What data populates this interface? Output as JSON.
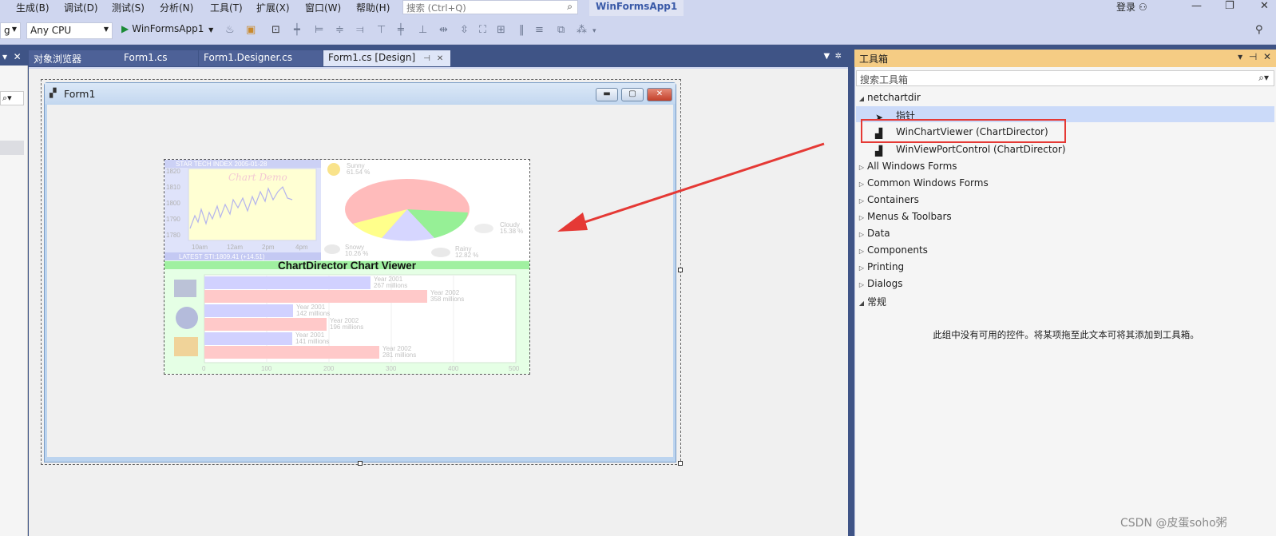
{
  "menubar": {
    "items": [
      "生成(B)",
      "调试(D)",
      "测试(S)",
      "分析(N)",
      "工具(T)",
      "扩展(X)",
      "窗口(W)",
      "帮助(H)"
    ],
    "search_placeholder": "搜索 (Ctrl+Q)",
    "app_title": "WinFormsApp1",
    "login": "登录"
  },
  "toolbar": {
    "config_combo": "g",
    "platform_combo": "Any CPU",
    "run_label": "WinFormsApp1"
  },
  "doc_tabs": {
    "tabs": [
      "对象浏览器",
      "Form1.cs",
      "Form1.Designer.cs",
      "Form1.cs [Design]"
    ]
  },
  "designer": {
    "form_title": "Form1",
    "control_caption": "ChartDirector Chart Viewer",
    "demo": {
      "stock_title": "STAR TECH INDEX  2005-01-28",
      "stock_watermark": "Chart Demo",
      "stock_ylabels": [
        "1820",
        "1810",
        "1800",
        "1790",
        "1780"
      ],
      "stock_xlabels": [
        "10am",
        "12am",
        "2pm",
        "4pm"
      ],
      "stock_footer": "LATEST  STI:1809.41 (+14.51)",
      "pie_labels": [
        {
          "name": "Sunny",
          "pct": "61.54 %"
        },
        {
          "name": "Cloudy",
          "pct": "15.38 %"
        },
        {
          "name": "Snowy",
          "pct": "10.26 %"
        },
        {
          "name": "Rainy",
          "pct": "12.82 %"
        }
      ],
      "bar_labels": [
        {
          "year": "Year 2001",
          "value": "267 millions"
        },
        {
          "year": "Year 2002",
          "value": "358 millions"
        },
        {
          "year": "Year 2001",
          "value": "142 millions"
        },
        {
          "year": "Year 2002",
          "value": "196 millions"
        },
        {
          "year": "Year 2001",
          "value": "141 millions"
        },
        {
          "year": "Year 2002",
          "value": "281 millions"
        }
      ],
      "bar_axis": [
        "0",
        "100",
        "200",
        "300",
        "400",
        "500"
      ]
    }
  },
  "toolbox": {
    "title": "工具箱",
    "search_placeholder": "搜索工具箱",
    "group_netchartdir": "netchartdir",
    "items": [
      "指针",
      "WinChartViewer (ChartDirector)",
      "WinViewPortControl (ChartDirector)"
    ],
    "groups": [
      "All Windows Forms",
      "Common Windows Forms",
      "Containers",
      "Menus & Toolbars",
      "Data",
      "Components",
      "Printing",
      "Dialogs"
    ],
    "group_general": "常规",
    "empty_message": "此组中没有可用的控件。将某项拖至此文本可将其添加到工具箱。"
  },
  "watermark": "CSDN @皮蛋soho粥",
  "colors": {
    "accent": "#f5cc84",
    "highlight_box": "#e53935",
    "annotation_arrow": "#e53935"
  }
}
